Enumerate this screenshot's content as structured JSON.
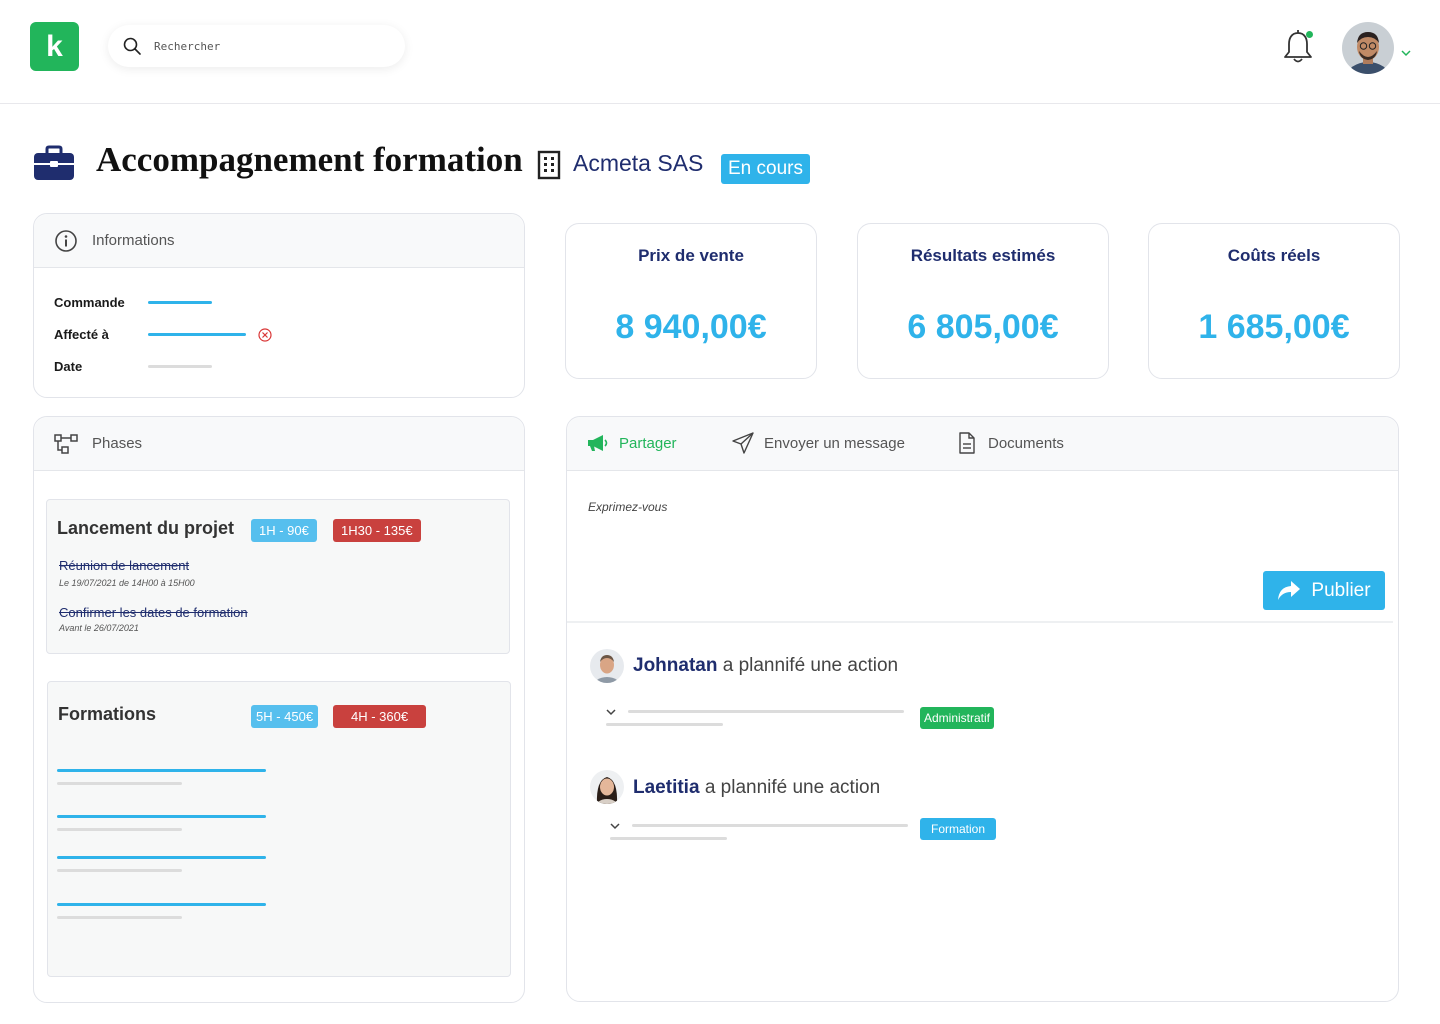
{
  "header": {
    "logo_letter": "k",
    "search_placeholder": "Rechercher"
  },
  "title": {
    "project": "Accompagnement formation",
    "company": "Acmeta SAS",
    "status": "En cours"
  },
  "informations": {
    "heading": "Informations",
    "fields": [
      "Commande",
      "Affecté à",
      "Date"
    ]
  },
  "stats": [
    {
      "label": "Prix de vente",
      "value": "8 940,00€"
    },
    {
      "label": "Résultats estimés",
      "value": "6 805,00€"
    },
    {
      "label": "Coûts réels",
      "value": "1 685,00€"
    }
  ],
  "phases": {
    "heading": "Phases",
    "launch": {
      "title": "Lancement du projet",
      "planned": "1H - 90€",
      "actual": "1H30 - 135€",
      "tasks": [
        {
          "name": "Réunion de lancement",
          "detail": "Le 19/07/2021 de 14H00 à 15H00"
        },
        {
          "name": "Confirmer les dates de formation",
          "detail": "Avant le 26/07/2021"
        }
      ]
    },
    "formations": {
      "title": "Formations",
      "planned": "5H - 450€",
      "actual": "4H - 360€"
    }
  },
  "activity": {
    "tabs": [
      "Partager",
      "Envoyer un message",
      "Documents"
    ],
    "compose_placeholder": "Exprimez-vous",
    "publish_label": "Publier",
    "feed": [
      {
        "user": "Johnatan",
        "action": "a plannifé une action",
        "tag": "Administratif"
      },
      {
        "user": "Laetitia",
        "action": "a plannifé une action",
        "tag": "Formation"
      }
    ]
  },
  "colors": {
    "brand_green": "#22b55b",
    "accent_blue": "#2fb3ea",
    "navy": "#1f2d6e",
    "danger_red": "#c9413e"
  }
}
